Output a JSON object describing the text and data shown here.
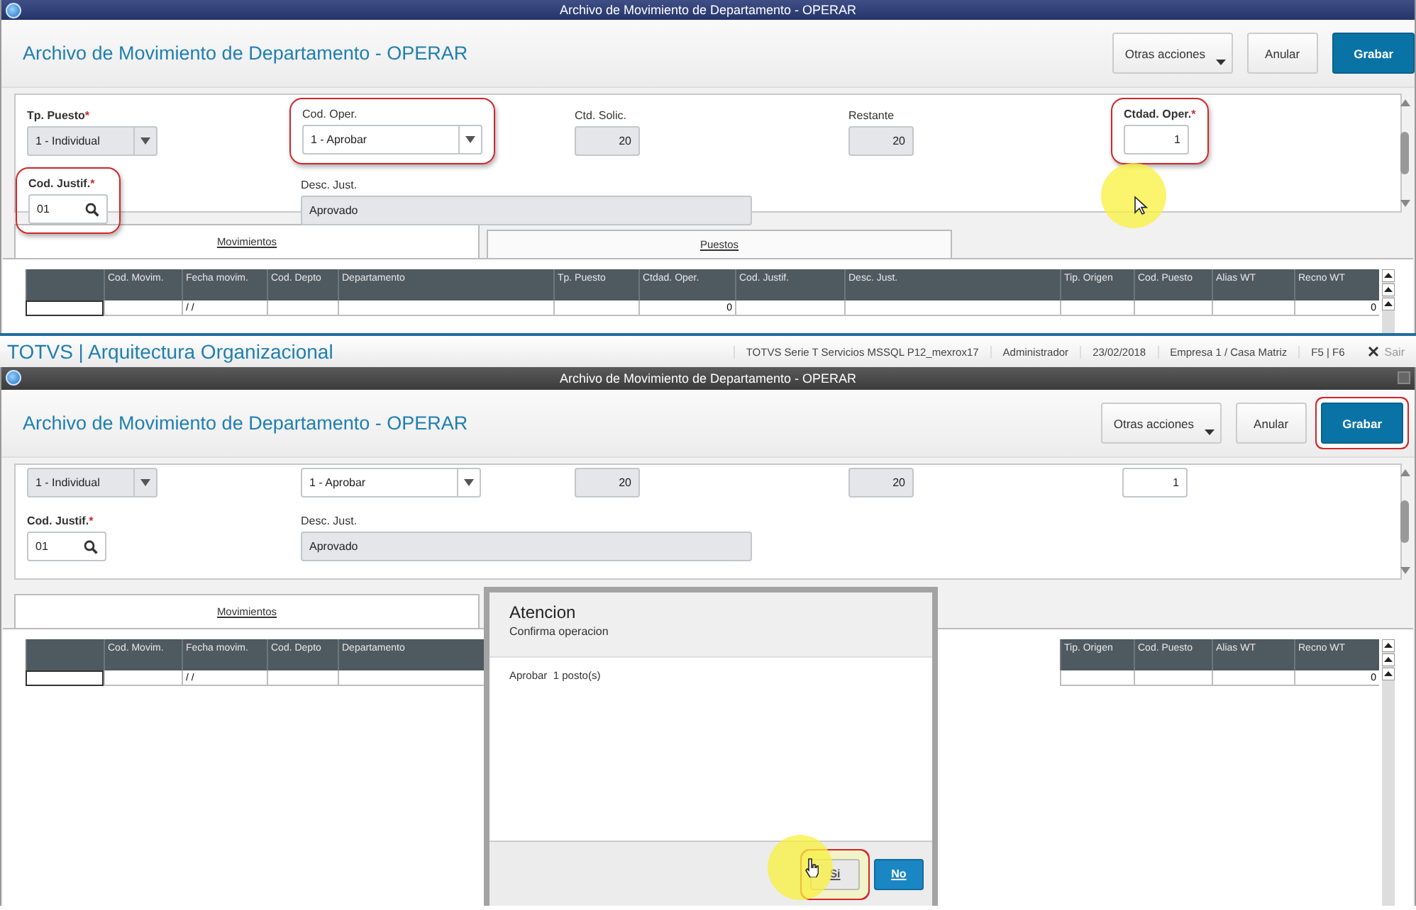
{
  "top_window": {
    "title": "Archivo de Movimiento de Departamento - OPERAR",
    "heading": "Archivo de Movimiento de Departamento - OPERAR",
    "actions": [
      {
        "label": "Otras acciones",
        "kind": "menu",
        "highlighted": false
      },
      {
        "label": "Anular",
        "kind": "plain",
        "highlighted": false
      },
      {
        "label": "Grabar",
        "kind": "primary",
        "highlighted": false
      }
    ],
    "form_rows": [
      [
        {
          "label": "Tp. Puesto",
          "required": true,
          "required_mark": "*",
          "kind": "select",
          "value": "1 - Individual",
          "disabled": true,
          "highlighted": false
        },
        {
          "label": "Cod. Oper.",
          "required": false,
          "kind": "select",
          "value": "1 - Aprobar",
          "disabled": false,
          "highlighted": true
        },
        {
          "label": "Ctd. Solic.",
          "required": false,
          "kind": "number",
          "value": "20",
          "disabled": true,
          "highlighted": false
        },
        {
          "label": "Restante",
          "required": false,
          "kind": "number",
          "value": "20",
          "disabled": true,
          "highlighted": false
        },
        {
          "label": "Ctdad. Oper.",
          "required": true,
          "required_mark": "*",
          "kind": "number",
          "value": "1",
          "disabled": false,
          "highlighted": true
        }
      ],
      [
        {
          "label": "Cod. Justif.",
          "required": true,
          "required_mark": "*",
          "kind": "lookup",
          "value": "01",
          "disabled": false,
          "highlighted": true
        },
        {
          "label": "Desc. Just.",
          "required": false,
          "kind": "text",
          "value": "Aprovado",
          "disabled": true,
          "highlighted": false
        }
      ]
    ],
    "tabs": [
      {
        "label": "Movimientos",
        "selected": true
      },
      {
        "label": "Puestos",
        "selected": false
      }
    ],
    "table": {
      "columns": [
        "",
        "Cod. Movim.",
        "Fecha movim.",
        "Cod. Depto",
        "Departamento",
        "Tp. Puesto",
        "Ctdad. Oper.",
        "Cod. Justif.",
        "Desc. Just.",
        "Tip. Origen",
        "Cod. Puesto",
        "Alias WT",
        "Recno WT"
      ],
      "rows": [
        [
          "",
          "",
          "/ /",
          "",
          "",
          "",
          "0",
          "",
          "",
          "",
          "",
          "",
          "0"
        ]
      ]
    }
  },
  "app_bar": {
    "title": "TOTVS | Arquitectura Organizacional",
    "items": [
      "TOTVS Serie T Servicios MSSQL P12_mexrox17",
      "Administrador",
      "23/02/2018",
      "Empresa 1 / Casa Matriz",
      "F5 | F6"
    ],
    "exit": "Sair"
  },
  "bottom_window": {
    "title": "Archivo de Movimiento de Departamento - OPERAR",
    "heading": "Archivo de Movimiento de Departamento - OPERAR",
    "actions": [
      {
        "label": "Otras acciones",
        "kind": "menu",
        "highlighted": false
      },
      {
        "label": "Anular",
        "kind": "plain",
        "highlighted": false
      },
      {
        "label": "Grabar",
        "kind": "primary",
        "highlighted": true
      }
    ],
    "form_rows": [
      [
        {
          "kind": "select",
          "value": "1 - Individual",
          "disabled": true
        },
        {
          "kind": "select",
          "value": "1 - Aprobar",
          "disabled": false
        },
        {
          "kind": "number",
          "value": "20",
          "disabled": true
        },
        {
          "kind": "number",
          "value": "20",
          "disabled": true
        },
        {
          "kind": "number",
          "value": "1",
          "disabled": false
        }
      ],
      [
        {
          "label": "Cod. Justif.",
          "required": true,
          "required_mark": "*",
          "kind": "lookup",
          "value": "01",
          "disabled": false,
          "highlighted": false
        },
        {
          "label": "Desc. Just.",
          "required": false,
          "kind": "text",
          "value": "Aprovado",
          "disabled": true,
          "highlighted": false
        }
      ]
    ],
    "tabs": [
      {
        "label": "Movimientos",
        "selected": true
      }
    ],
    "table": {
      "columns": [
        "",
        "Cod. Movim.",
        "Fecha movim.",
        "Cod. Depto",
        "Departamento",
        "Tip. Origen",
        "Cod. Puesto",
        "Alias WT",
        "Recno WT"
      ],
      "rows": [
        [
          "",
          "",
          "/ /",
          "",
          "",
          "",
          "",
          "",
          "0"
        ]
      ]
    },
    "dialog": {
      "title": "Atencion",
      "subtitle": "Confirma operacion",
      "message": "Aprobar  1 posto(s)",
      "buttons": [
        {
          "label": "Si",
          "kind": "plain",
          "highlighted": true
        },
        {
          "label": "No",
          "kind": "primary",
          "highlighted": false
        }
      ]
    }
  }
}
